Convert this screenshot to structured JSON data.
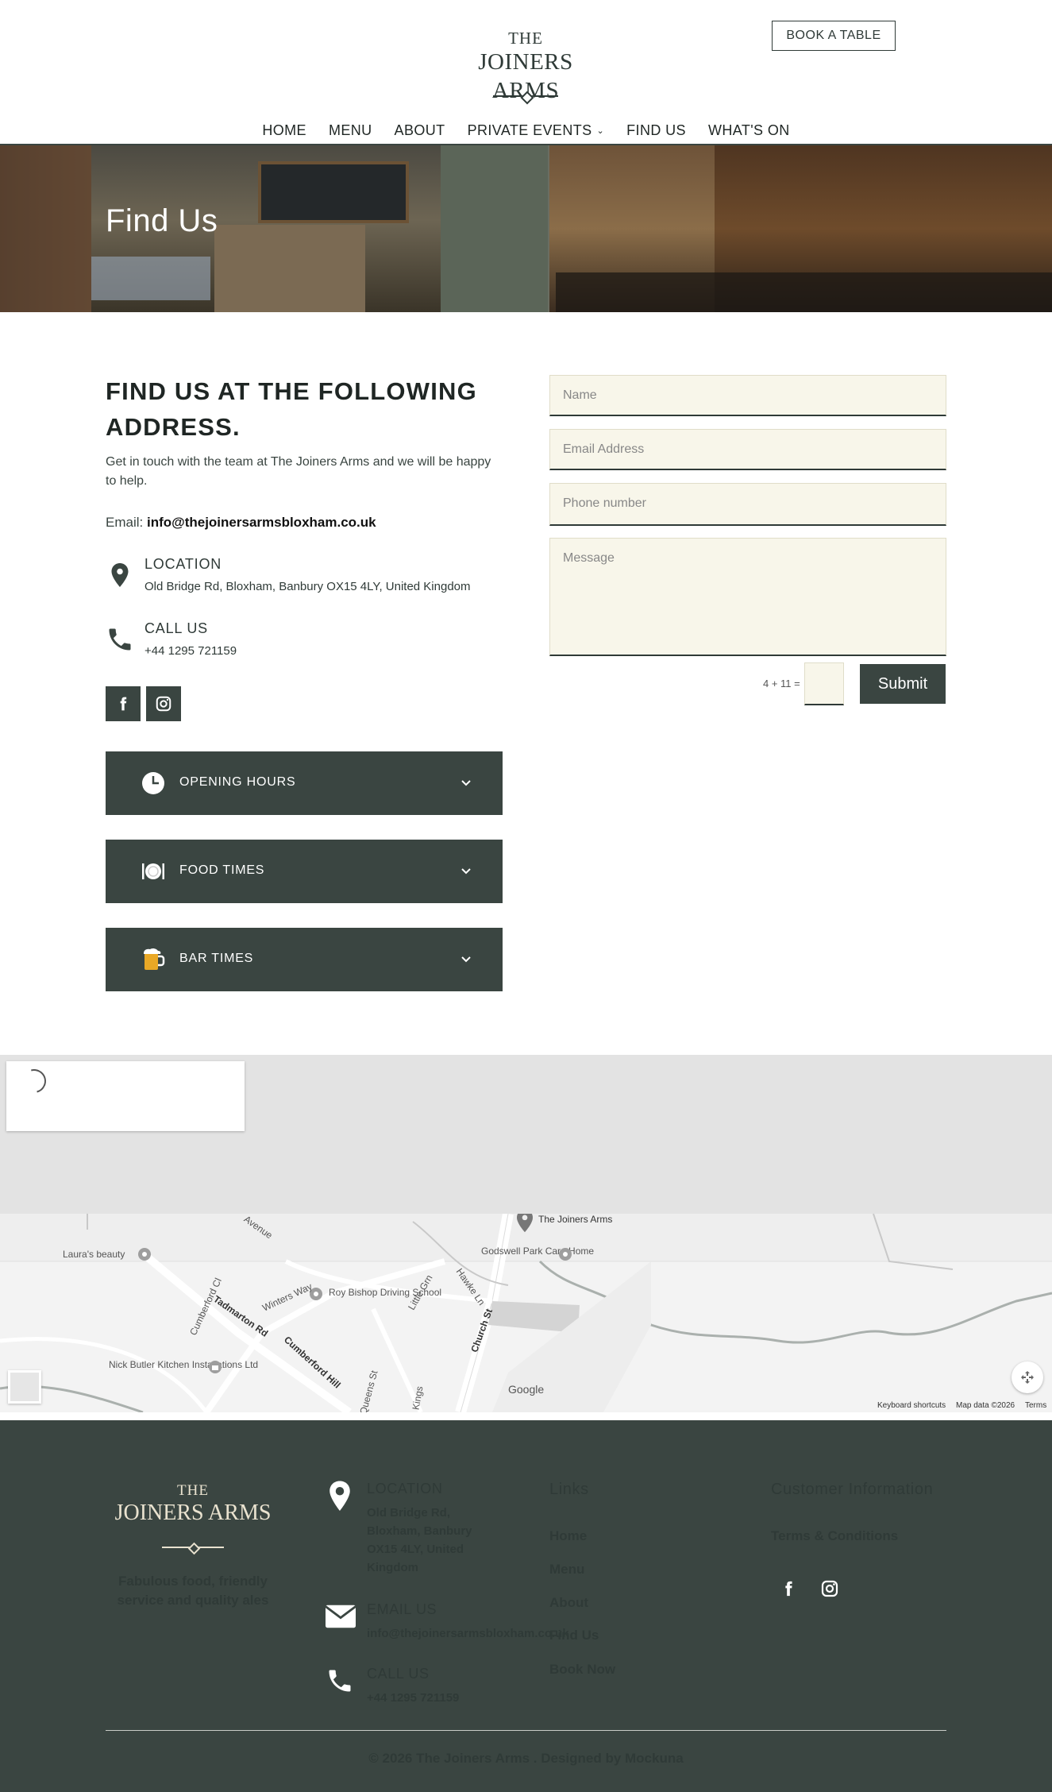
{
  "header": {
    "logo_the": "THE",
    "logo_name": "JOINERS ARMS",
    "book_button": "BOOK A TABLE",
    "nav": [
      "HOME",
      "MENU",
      "ABOUT",
      "PRIVATE EVENTS",
      "FIND US",
      "WHAT'S ON"
    ]
  },
  "hero": {
    "title": "Find Us"
  },
  "contact": {
    "title": "FIND US AT THE FOLLOWING ADDRESS.",
    "intro": "Get in touch with the team at The Joiners Arms and we will be happy to help.",
    "email_label": "Email:",
    "email": "info@thejoinersarmsbloxham.co.uk",
    "location_label": "LOCATION",
    "location_value": "Old Bridge Rd, Bloxham, Banbury OX15 4LY, United Kingdom",
    "call_label": "CALL US",
    "call_value": "+44 1295 721159",
    "social_icons": [
      "facebook-icon",
      "instagram-icon"
    ],
    "accordions": [
      {
        "label": "OPENING HOURS",
        "icon": "clock-icon"
      },
      {
        "label": "FOOD TIMES",
        "icon": "plate-cutlery-icon"
      },
      {
        "label": "BAR TIMES",
        "icon": "beer-mug-icon"
      }
    ]
  },
  "form": {
    "name_placeholder": "Name",
    "email_placeholder": "Email Address",
    "phone_placeholder": "Phone number",
    "message_placeholder": "Message",
    "captcha": "4 + 11 =",
    "submit": "Submit"
  },
  "map": {
    "place": "The Joiners Arms",
    "labels": [
      "Laura's beauty",
      "Godswell Park Care Home",
      "Roy Bishop Driving School",
      "Nick Butler Kitchen Installations Ltd"
    ],
    "roads": [
      "Tadmarton Rd",
      "Cumberford Hill",
      "Church St",
      "Winters Way",
      "Hawke Ln",
      "Little Grn",
      "Queens St",
      "Kings",
      "Cumberford Cl",
      "Avenue"
    ],
    "google": "Google",
    "shortcuts": "Keyboard shortcuts",
    "map_data": "Map data ©2026",
    "terms": "Terms"
  },
  "footer": {
    "logo_the": "THE",
    "logo_name": "JOINERS ARMS",
    "tagline": "Fabulous food, friendly service and quality ales",
    "location_label": "LOCATION",
    "location_value": "Old Bridge Rd, Bloxham, Banbury OX15 4LY, United Kingdom",
    "email_label": "EMAIL US",
    "email_value": "info@thejoinersarmsbloxham.co.uk",
    "call_label": "CALL US",
    "call_value": "+44 1295 721159",
    "links_heading": "Links",
    "links": [
      "Home",
      "Menu",
      "About",
      "Find Us",
      "Book Now"
    ],
    "customer_heading": "Customer Information",
    "terms": "Terms & Conditions",
    "copyright": "© 2026 The Joiners Arms . Designed by Mockuna"
  },
  "colors": {
    "dark_green": "#3a4541",
    "cream": "#f8f6ea",
    "footer_logo": "#e9e2cf"
  }
}
